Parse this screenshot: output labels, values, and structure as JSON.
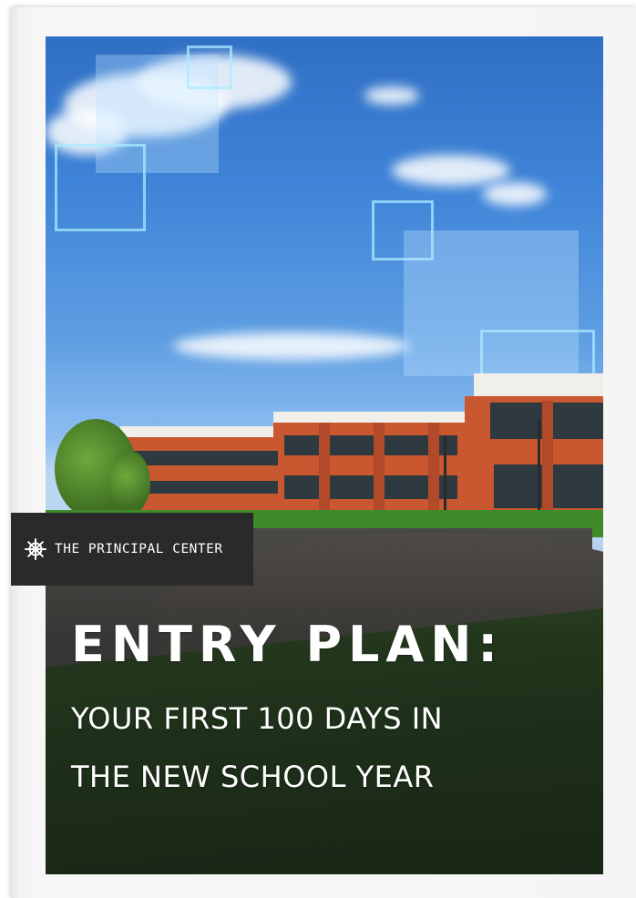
{
  "cover": {
    "brand": {
      "icon": "ships-wheel-icon",
      "name": "THE PRINCIPAL CENTER"
    },
    "title": "ENTRY PLAN:",
    "subtitle_lines": [
      "YOUR FIRST 100 DAYS IN",
      "THE NEW SCHOOL YEAR"
    ]
  },
  "colors": {
    "band": "#2a2a2a",
    "text": "#ffffff",
    "sky": "#3f84d8",
    "brick": "#c9572f",
    "grass": "#23401c"
  }
}
